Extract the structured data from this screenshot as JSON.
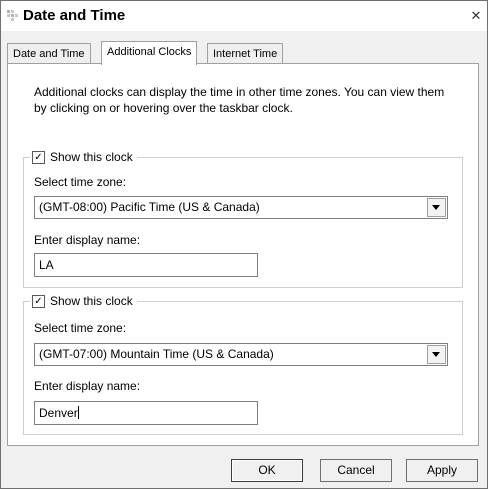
{
  "window": {
    "title": "Date and Time"
  },
  "tabs": [
    {
      "label": "Date and Time"
    },
    {
      "label": "Additional Clocks"
    },
    {
      "label": "Internet Time"
    }
  ],
  "description": "Additional clocks can display the time in other time zones. You can view them by clicking on or hovering over the taskbar clock.",
  "clocks": [
    {
      "show_label": "Show this clock",
      "checked": true,
      "timezone_label": "Select time zone:",
      "timezone_value": "(GMT-08:00) Pacific Time (US & Canada)",
      "name_label": "Enter display name:",
      "name_value": "LA"
    },
    {
      "show_label": "Show this clock",
      "checked": true,
      "timezone_label": "Select time zone:",
      "timezone_value": "(GMT-07:00) Mountain Time (US & Canada)",
      "name_label": "Enter display name:",
      "name_value": "Denver"
    }
  ],
  "buttons": {
    "ok": "OK",
    "cancel": "Cancel",
    "apply": "Apply"
  }
}
